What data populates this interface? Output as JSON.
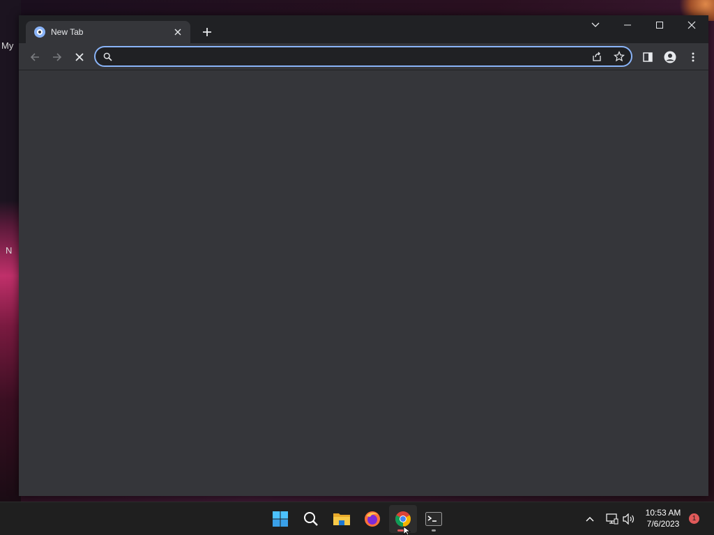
{
  "desktop": {
    "fragments": [
      "My",
      "N"
    ]
  },
  "browser": {
    "tab": {
      "title": "New Tab",
      "favicon": "chrome-newtab-icon",
      "close_icon": "close-icon"
    },
    "new_tab_icon": "plus-icon",
    "window_controls": [
      "tab-search-icon",
      "minimize-icon",
      "maximize-icon",
      "close-icon"
    ],
    "toolbar": {
      "back_icon": "arrow-back-icon",
      "forward_icon": "arrow-forward-icon",
      "stop_icon": "stop-loading-icon",
      "omnibox": {
        "value": "",
        "search_icon": "search-icon",
        "share_icon": "share-icon",
        "bookmark_icon": "star-icon"
      },
      "side_panel_icon": "side-panel-icon",
      "profile_icon": "profile-icon",
      "menu_icon": "more-vert-icon"
    },
    "colors": {
      "frame": "#202124",
      "toolbar": "#35363a",
      "accent": "#8ab4f8",
      "text": "#e8eaed"
    }
  },
  "taskbar": {
    "apps": [
      {
        "name": "start",
        "icon": "windows-start-icon",
        "active": false
      },
      {
        "name": "search",
        "icon": "search-icon",
        "active": false
      },
      {
        "name": "file-explorer",
        "icon": "folder-icon",
        "active": false
      },
      {
        "name": "firefox",
        "icon": "firefox-icon",
        "active": false
      },
      {
        "name": "chrome",
        "icon": "chrome-icon",
        "active": true
      },
      {
        "name": "terminal",
        "icon": "terminal-icon",
        "active": false
      }
    ],
    "tray": {
      "overflow_icon": "chevron-up-icon",
      "network_icon": "network-icon",
      "volume_icon": "volume-icon"
    },
    "clock": {
      "time": "10:53 AM",
      "date": "7/6/2023"
    },
    "notification_count": "1"
  }
}
